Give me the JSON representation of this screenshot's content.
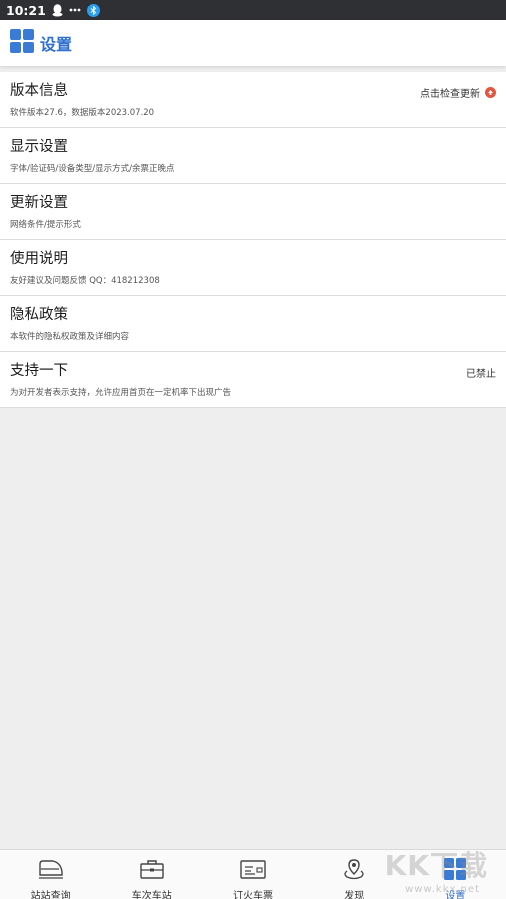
{
  "status_bar": {
    "time": "10:21",
    "icons": [
      "qq-icon",
      "more-dots-icon",
      "bluetooth-icon"
    ]
  },
  "header": {
    "title": "设置",
    "icon": "grid-icon",
    "accent": "#2f6fcf"
  },
  "settings": [
    {
      "title": "版本信息",
      "subtitle": "软件版本27.6，数据版本2023.07.20",
      "right": "点击检查更新"
    },
    {
      "title": "显示设置",
      "subtitle": "字体/验证码/设备类型/显示方式/余票正晚点",
      "right": ""
    },
    {
      "title": "更新设置",
      "subtitle": "网络条件/提示形式",
      "right": ""
    },
    {
      "title": "使用说明",
      "subtitle": "友好建议及问题反馈 QQ：418212308",
      "right": ""
    },
    {
      "title": "隐私政策",
      "subtitle": "本软件的隐私权政策及详细内容",
      "right": ""
    },
    {
      "title": "支持一下",
      "subtitle": "为对开发者表示支持，允许应用首页在一定机率下出现广告",
      "right": "已禁止"
    }
  ],
  "bottom_nav": [
    {
      "label": "站站查询",
      "icon": "train-icon",
      "active": false
    },
    {
      "label": "车次车站",
      "icon": "station-icon",
      "active": false
    },
    {
      "label": "订火车票",
      "icon": "ticket-icon",
      "active": false
    },
    {
      "label": "发现",
      "icon": "compass-icon",
      "active": false
    },
    {
      "label": "设置",
      "icon": "grid-icon",
      "active": true
    }
  ],
  "watermark": {
    "logo": "KK下载",
    "url": "www.kkx.net"
  },
  "colors": {
    "update_badge": "#e4553f",
    "active_tab": "#2f6fcf"
  }
}
